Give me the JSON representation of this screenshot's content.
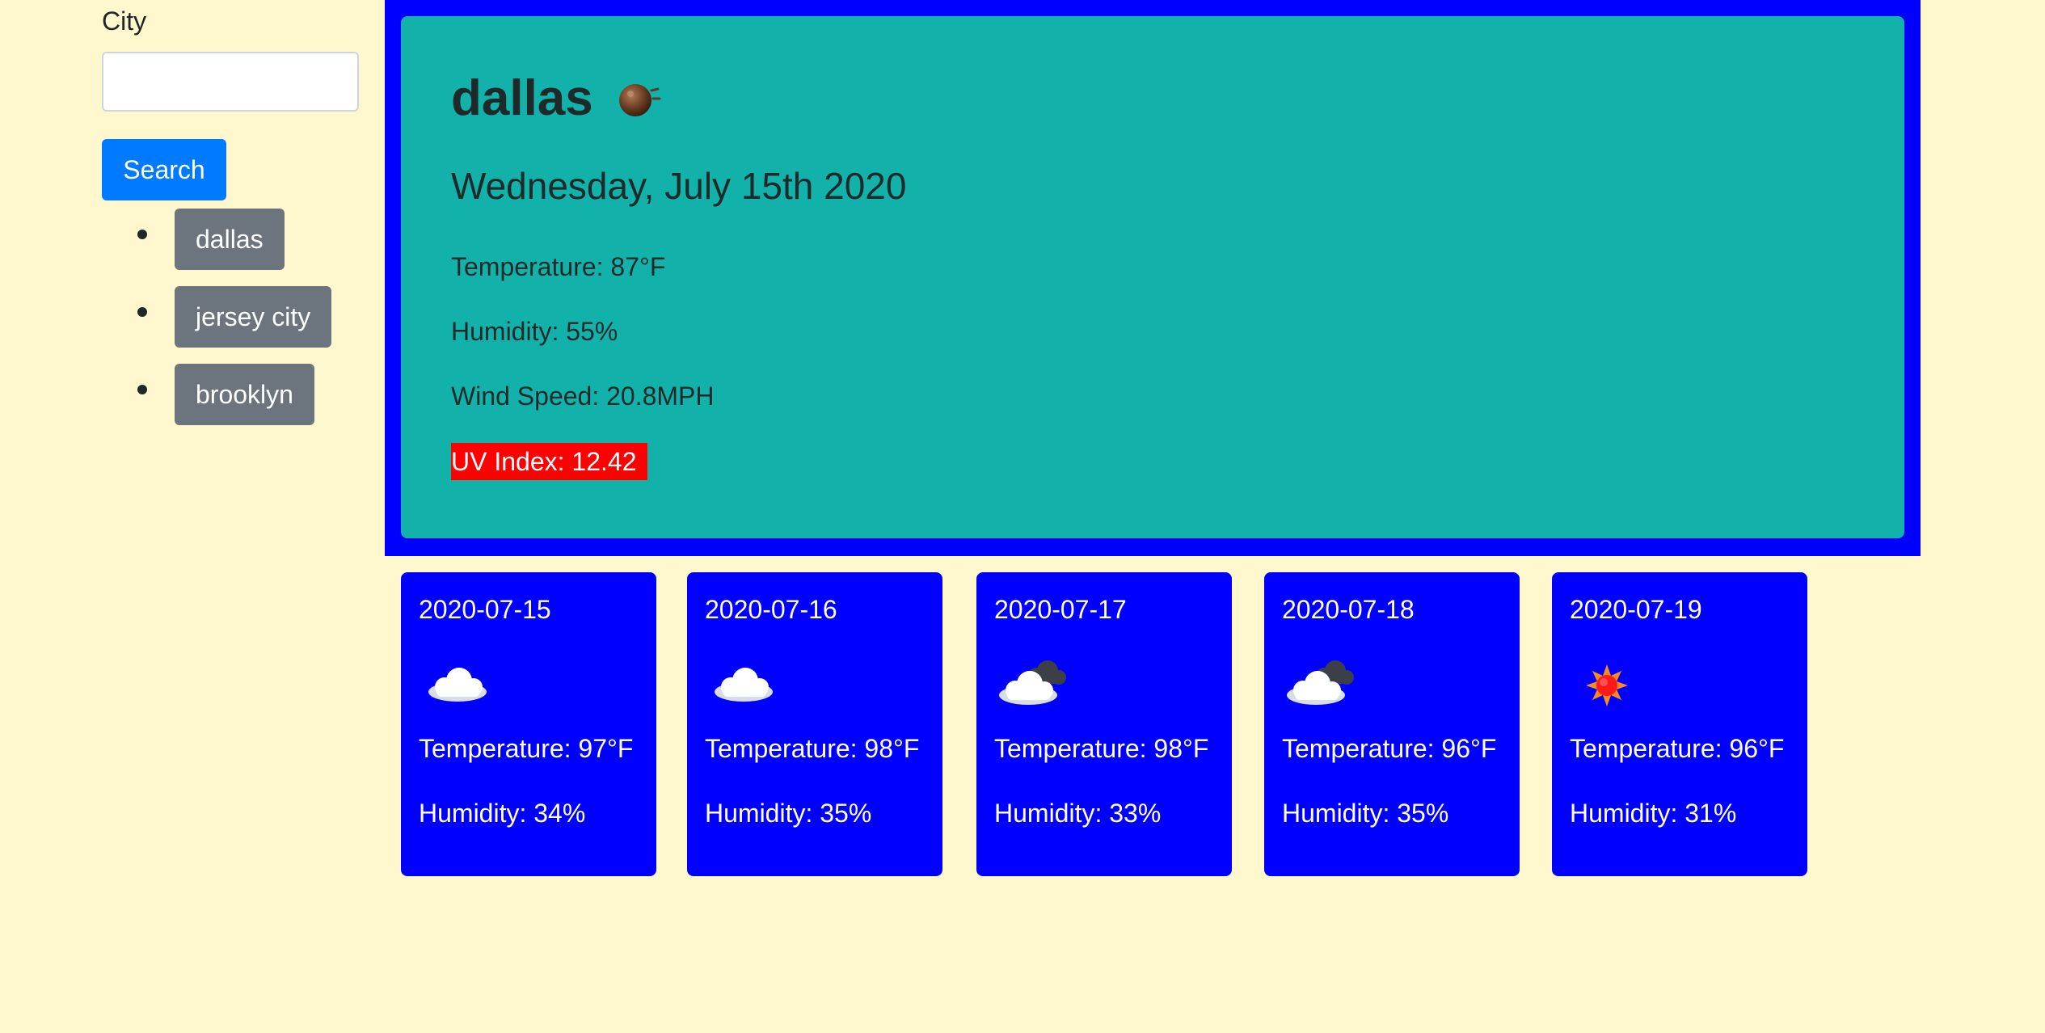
{
  "sidebar": {
    "city_label": "City",
    "search_input": {
      "value": "",
      "placeholder": ""
    },
    "search_button_label": "Search",
    "history": [
      "dallas",
      "jersey city",
      "brooklyn"
    ]
  },
  "current": {
    "city": "dallas",
    "icon": "haze-icon",
    "date": "Wednesday, July 15th 2020",
    "temperature": "Temperature: 87°F",
    "humidity": "Humidity: 55%",
    "wind_speed": "Wind Speed: 20.8MPH",
    "uv_index": "UV Index: 12.42",
    "uv_color": "#ff0000"
  },
  "forecast": [
    {
      "date": "2020-07-15",
      "icon": "cloud-icon",
      "temperature": "Temperature: 97°F",
      "humidity": "Humidity: 34%"
    },
    {
      "date": "2020-07-16",
      "icon": "cloud-icon",
      "temperature": "Temperature: 98°F",
      "humidity": "Humidity: 35%"
    },
    {
      "date": "2020-07-17",
      "icon": "broken-clouds-icon",
      "temperature": "Temperature: 98°F",
      "humidity": "Humidity: 33%"
    },
    {
      "date": "2020-07-18",
      "icon": "broken-clouds-icon",
      "temperature": "Temperature: 96°F",
      "humidity": "Humidity: 35%"
    },
    {
      "date": "2020-07-19",
      "icon": "sun-icon",
      "temperature": "Temperature: 96°F",
      "humidity": "Humidity: 31%"
    }
  ],
  "colors": {
    "page_background": "#fff8cf",
    "panel_blue": "#0000ff",
    "current_card": "#12b2aa",
    "primary_button": "#007bff",
    "history_button": "#6c757d",
    "uv_badge": "#ff0000"
  }
}
